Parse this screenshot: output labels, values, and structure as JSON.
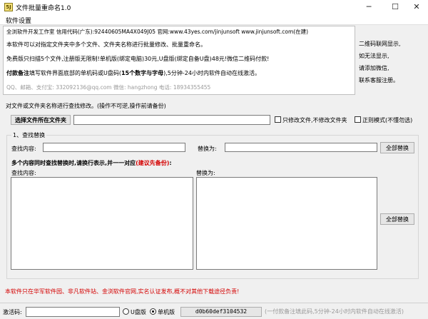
{
  "window": {
    "title": "文件批量重命名1.0",
    "icon_text": "5J",
    "controls": {
      "minimize": "─",
      "maximize": "☐",
      "close": "✕"
    }
  },
  "menu": {
    "items": [
      "软件设置"
    ]
  },
  "info": {
    "line1": "全浏软件开发工作室 信用代码(广东):92440605MA4X049J05 官网:www.43yes.com/jinjunsoft  www.jinjunsoft.com(在建)",
    "line2": "本软件可以对指定文件夹中多个文件、文件夹名称进行批量修改、批量重命名。",
    "line3": "免费版只扫描5个文件,注册版无限制!单机版(绑定电脑)30元,U盘版(绑定自备U盘)48元!微信二维码付款!",
    "line4_bold": "付款备注",
    "line4_rest": "填写软件界面底部的单机码或U盘码(",
    "line4_bold2": "15个数字与字母",
    "line4_end": "),5分钟-24小时内软件自动在线激活。",
    "line5": "QQ、邮箱、支付宝: 332092136@qq.com     微信: hangzhong     电话: 18934355455"
  },
  "side_notes": [
    "二维码联网显示,",
    "如无法显示,",
    "请添加微信,",
    "联系客服注册。"
  ],
  "task": {
    "description": "对文件或文件夹名称进行查找修改。(操作不可逆,操作前请备份)",
    "select_folder_button": "选择文件所在文件夹",
    "folder_path": "",
    "only_files_label": "只修改文件,不修改文件夹",
    "regex_label": "正则模式(不懂勿选)"
  },
  "replace_group": {
    "title": "1、查找替换",
    "find_label": "查找内容:",
    "find_value": "",
    "replace_label": "替换为:",
    "replace_value": "",
    "replace_all_button": "全部替换",
    "multi_heading": "多个内容同时查找替换时,请换行表示,并一一对应",
    "multi_note": "(建议先备份)",
    "multi_heading_end": ":",
    "multi_find_label": "查找内容:",
    "multi_replace_label": "替换为:",
    "multi_replace_all_button": "全部替换"
  },
  "footer": {
    "warning": "本软件只在华军软件园、非凡软件站、金浏软件官网,实名认证发布,概不对其他下载途径负责!",
    "activation_label": "激活码:",
    "activation_value": "",
    "usb_option": "U盘版",
    "single_option": "单机版",
    "selected_option": "单机版",
    "machine_code": "d0b60def3104532",
    "hint": "(一付款备注填此码,5分钟-24小时内软件自动在线激活)"
  },
  "colors": {
    "warning_red": "#d40000",
    "hint_gray": "#999999"
  }
}
